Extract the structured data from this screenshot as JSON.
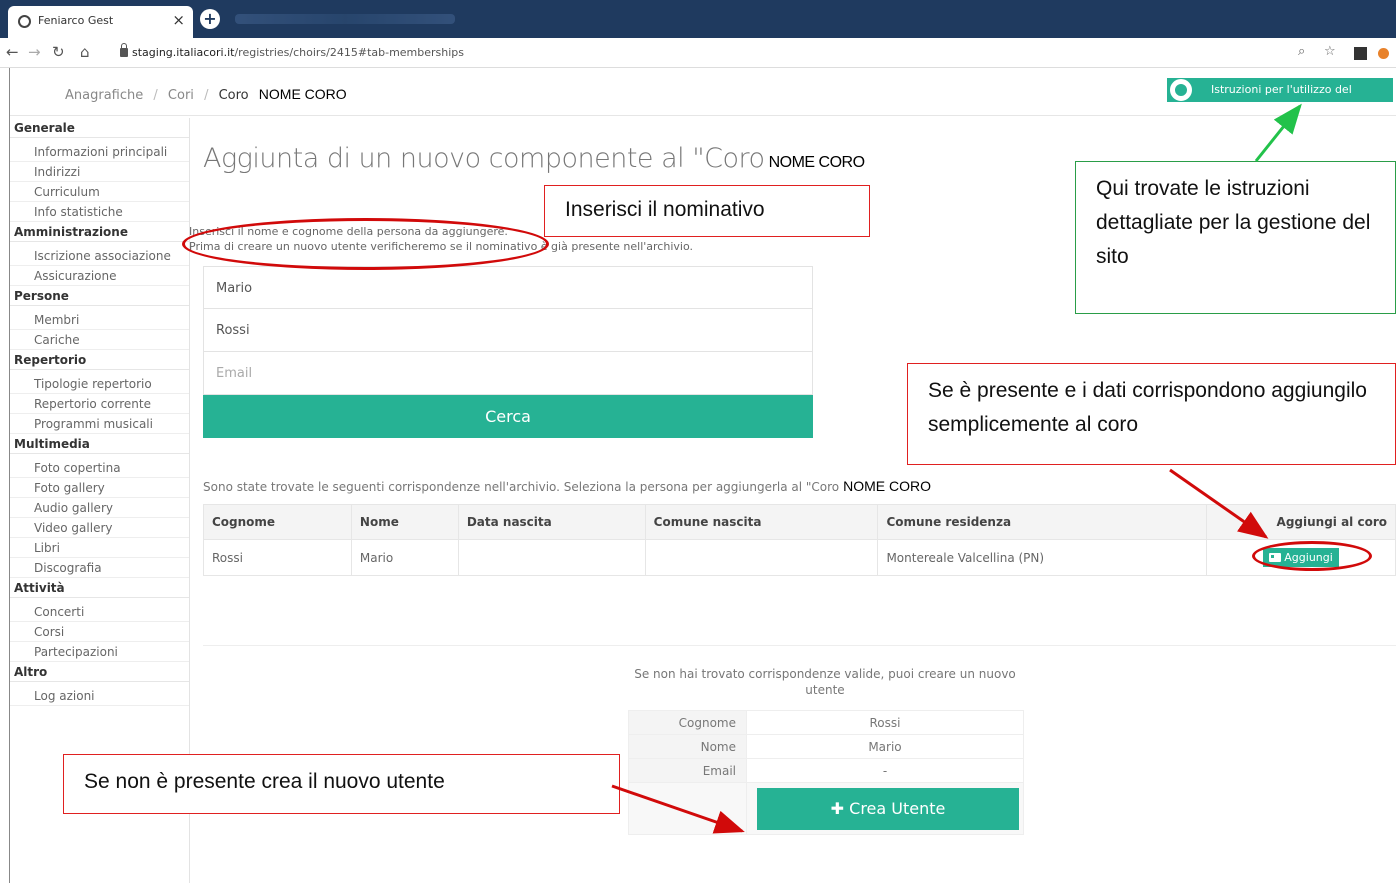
{
  "browser": {
    "tab_title": "Feniarco Gest",
    "tab_close": "×",
    "new_tab": "+",
    "url_host": "staging.italiacori.it",
    "url_path": "/registries/choirs/2415#tab-memberships"
  },
  "breadcrumb": {
    "item1": "Anagrafiche",
    "item2": "Cori",
    "sep": "/",
    "current": "Coro",
    "current_name": "NOME CORO"
  },
  "help_button": "Istruzioni per l'utilizzo del portale",
  "sidebar": [
    {
      "section": "Generale",
      "items": [
        "Informazioni principali",
        "Indirizzi",
        "Curriculum",
        "Info statistiche"
      ]
    },
    {
      "section": "Amministrazione",
      "items": [
        "Iscrizione associazione",
        "Assicurazione"
      ]
    },
    {
      "section": "Persone",
      "items": [
        "Membri",
        "Cariche"
      ]
    },
    {
      "section": "Repertorio",
      "items": [
        "Tipologie repertorio",
        "Repertorio corrente",
        "Programmi musicali"
      ]
    },
    {
      "section": "Multimedia",
      "items": [
        "Foto copertina",
        "Foto gallery",
        "Audio gallery",
        "Video gallery",
        "Libri",
        "Discografia"
      ]
    },
    {
      "section": "Attività",
      "items": [
        "Concerti",
        "Corsi",
        "Partecipazioni"
      ]
    },
    {
      "section": "Altro",
      "items": [
        "Log azioni"
      ]
    }
  ],
  "main": {
    "heading": "Aggiunta di un nuovo componente al \"Coro",
    "heading_name": "NOME CORO",
    "instruction_line1": "Inserisci il nome e cognome della persona da aggiungere.",
    "instruction_line2": "Prima di creare un nuovo utente verificheremo se il nominativo è già presente nell'archivio.",
    "form": {
      "nome_value": "Mario",
      "cognome_value": "Rossi",
      "email_placeholder": "Email",
      "search_button": "Cerca"
    },
    "results_message": "Sono state trovate le seguenti corrispondenze nell'archivio. Seleziona la persona per aggiungerla al \"Coro",
    "results_name": "NOME CORO",
    "results_table": {
      "headers": [
        "Cognome",
        "Nome",
        "Data nascita",
        "Comune nascita",
        "Comune residenza",
        "Aggiungi al coro"
      ],
      "rows": [
        {
          "cognome": "Rossi",
          "nome": "Mario",
          "data_nascita": "",
          "comune_nascita": "",
          "comune_residenza": "Montereale Valcellina (PN)",
          "action": "Aggiungi"
        }
      ]
    },
    "not_found_message": "Se non hai trovato corrispondenze valide, puoi creare un nuovo utente",
    "create_table": {
      "cognome_label": "Cognome",
      "cognome_value": "Rossi",
      "nome_label": "Nome",
      "nome_value": "Mario",
      "email_label": "Email",
      "email_value": "-",
      "create_button": "Crea Utente"
    }
  },
  "annotations": {
    "nominativo": "Inserisci il nominativo",
    "istruzioni": "Qui trovate le istruzioni dettagliate per la gestione del sito",
    "aggiungi": "Se è presente e i dati corrispondono aggiungilo semplicemente al coro",
    "crea": "Se non è presente crea il nuovo utente"
  },
  "colors": {
    "accent": "#26b294",
    "annotation_red": "#e02020",
    "annotation_green": "#2a9d48"
  }
}
